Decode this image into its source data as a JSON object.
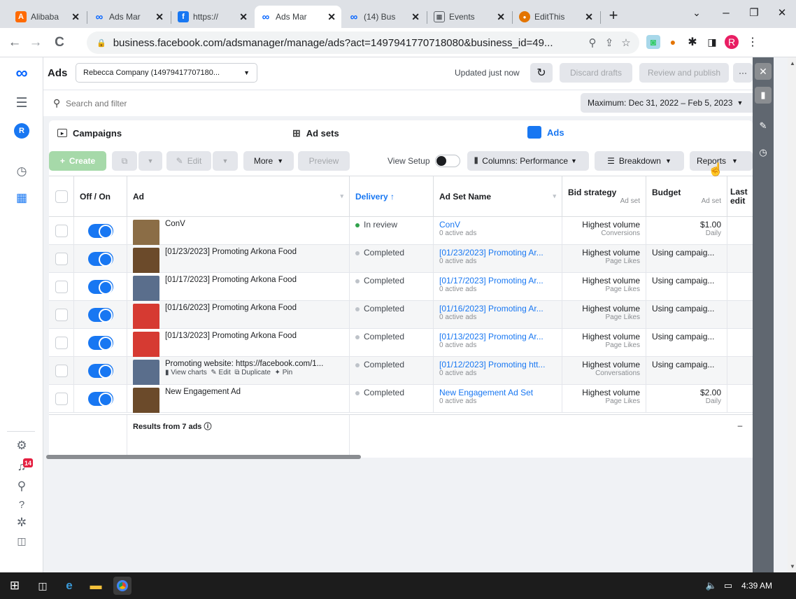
{
  "browser": {
    "tabs": [
      {
        "title": "Alibaba",
        "favicon": "A",
        "color": "#ff6a00"
      },
      {
        "title": "Ads Mar",
        "favicon": "∞",
        "color": "#0866ff"
      },
      {
        "title": "https://",
        "favicon": "f",
        "color": "#1877f2"
      },
      {
        "title": "Ads Mar",
        "favicon": "∞",
        "color": "#0866ff"
      },
      {
        "title": "(14) Bus",
        "favicon": "∞",
        "color": "#0866ff"
      },
      {
        "title": "Events",
        "favicon": "▦",
        "color": "#5f6368"
      },
      {
        "title": "EditThis",
        "favicon": "🍪",
        "color": "#e37400"
      }
    ],
    "new_tab": "+",
    "url": "business.facebook.com/adsmanager/manage/ads?act=1497941770718080&business_id=49...",
    "window_controls": {
      "minimize": "–",
      "maximize": "❐",
      "close": "✕",
      "dropdown": "⌄"
    },
    "profile_initial": "R"
  },
  "leftrail": {
    "logo": "∞",
    "account_initial": "R",
    "notifications_badge": "14"
  },
  "header": {
    "title": "Ads",
    "account": "Rebecca Company (14979417707180...",
    "updated": "Updated just now",
    "discard": "Discard drafts",
    "review": "Review and publish",
    "more": "···"
  },
  "search": {
    "placeholder": "Search and filter",
    "date_range": "Maximum: Dec 31, 2022 – Feb 5, 2023"
  },
  "tabs": {
    "campaigns": "Campaigns",
    "adsets": "Ad sets",
    "ads": "Ads"
  },
  "actions": {
    "create": "Create",
    "edit": "Edit",
    "more": "More",
    "preview": "Preview",
    "view_setup": "View Setup",
    "columns": "Columns: Performance",
    "breakdown": "Breakdown",
    "reports": "Reports"
  },
  "table": {
    "headers": {
      "offon": "Off / On",
      "ad": "Ad",
      "delivery": "Delivery ↑",
      "adset_name": "Ad Set Name",
      "bid": "Bid strategy",
      "bid_sub": "Ad set",
      "budget": "Budget",
      "budget_sub": "Ad set",
      "last_edit": "Last edit"
    },
    "rows": [
      {
        "ad": "ConV",
        "delivery": "In review",
        "delivery_color": "#31a24c",
        "adset": "ConV",
        "adset_sub": "0 active ads",
        "bid": "Highest volume",
        "bid_sub": "Conversions",
        "budget": "$1.00",
        "budget_sub": "Daily",
        "thumb": "#8b6d46"
      },
      {
        "ad": "[01/23/2023] Promoting Arkona Food",
        "delivery": "Completed",
        "delivery_color": "#bec3c9",
        "adset": "[01/23/2023] Promoting Ar...",
        "adset_sub": "0 active ads",
        "bid": "Highest volume",
        "bid_sub": "Page Likes",
        "budget": "Using campaig...",
        "budget_sub": "",
        "thumb": "#6b4a2a"
      },
      {
        "ad": "[01/17/2023] Promoting Arkona Food",
        "delivery": "Completed",
        "delivery_color": "#bec3c9",
        "adset": "[01/17/2023] Promoting Ar...",
        "adset_sub": "0 active ads",
        "bid": "Highest volume",
        "bid_sub": "Page Likes",
        "budget": "Using campaig...",
        "budget_sub": "",
        "thumb": "#5a6e8c"
      },
      {
        "ad": "[01/16/2023] Promoting Arkona Food",
        "delivery": "Completed",
        "delivery_color": "#bec3c9",
        "adset": "[01/16/2023] Promoting Ar...",
        "adset_sub": "0 active ads",
        "bid": "Highest volume",
        "bid_sub": "Page Likes",
        "budget": "Using campaig...",
        "budget_sub": "",
        "thumb": "#d63a32"
      },
      {
        "ad": "[01/13/2023] Promoting Arkona Food",
        "delivery": "Completed",
        "delivery_color": "#bec3c9",
        "adset": "[01/13/2023] Promoting Ar...",
        "adset_sub": "0 active ads",
        "bid": "Highest volume",
        "bid_sub": "Page Likes",
        "budget": "Using campaig...",
        "budget_sub": "",
        "thumb": "#d63a32"
      },
      {
        "ad": "Promoting website: https://facebook.com/1...",
        "delivery": "Completed",
        "delivery_color": "#bec3c9",
        "adset": "[01/12/2023] Promoting htt...",
        "adset_sub": "0 active ads",
        "bid": "Highest volume",
        "bid_sub": "Conversations",
        "budget": "Using campaig...",
        "budget_sub": "",
        "thumb": "#5a6e8c"
      },
      {
        "ad": "New Engagement Ad",
        "delivery": "Completed",
        "delivery_color": "#bec3c9",
        "adset": "New Engagement Ad Set",
        "adset_sub": "0 active ads",
        "bid": "Highest volume",
        "bid_sub": "Page Likes",
        "budget": "$2.00",
        "budget_sub": "Daily",
        "thumb": "#6b4a2a"
      }
    ],
    "row_actions": {
      "view_charts": "View charts",
      "edit": "Edit",
      "duplicate": "Duplicate",
      "pin": "Pin"
    },
    "results": "Results from 7 ads",
    "last_edit_dash": "–"
  },
  "taskbar": {
    "time": "4:39 AM"
  }
}
